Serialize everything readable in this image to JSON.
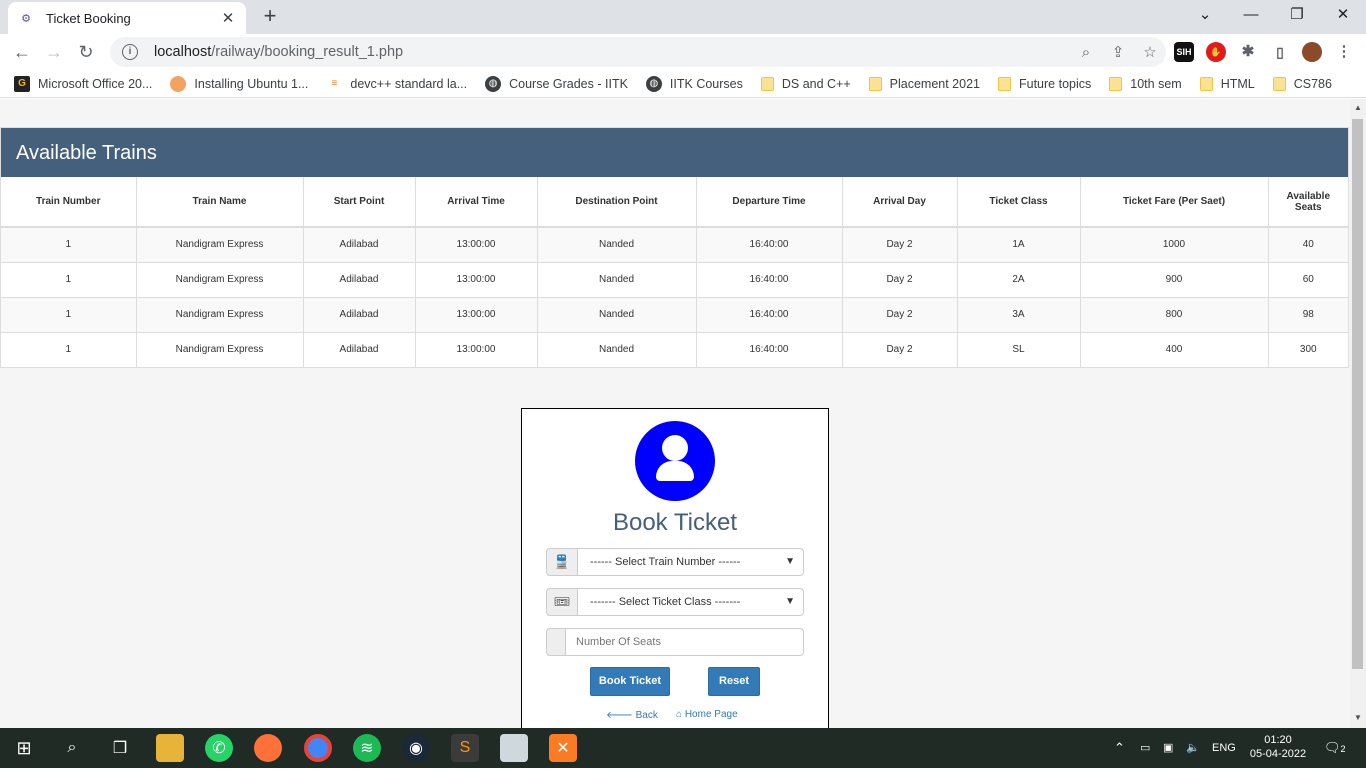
{
  "browser": {
    "tab_title": "Ticket Booking",
    "url_host": "localhost",
    "url_path": "/railway/booking_result_1.php",
    "bookmarks": [
      {
        "label": "Microsoft Office 20...",
        "icon": "office-icon"
      },
      {
        "label": "Installing Ubuntu 1...",
        "icon": "ubuntu-icon"
      },
      {
        "label": "devc++ standard la...",
        "icon": "stackoverflow-icon"
      },
      {
        "label": "Course Grades - IITK",
        "icon": "globe-icon"
      },
      {
        "label": "IITK Courses",
        "icon": "globe-icon"
      },
      {
        "label": "DS and C++",
        "icon": "folder-icon"
      },
      {
        "label": "Placement 2021",
        "icon": "folder-icon"
      },
      {
        "label": "Future topics",
        "icon": "folder-icon"
      },
      {
        "label": "10th sem",
        "icon": "folder-icon"
      },
      {
        "label": "HTML",
        "icon": "folder-icon"
      },
      {
        "label": "CS786",
        "icon": "folder-icon"
      }
    ]
  },
  "trains": {
    "heading": "Available Trains",
    "columns": [
      "Train Number",
      "Train Name",
      "Start Point",
      "Arrival Time",
      "Destination Point",
      "Departure Time",
      "Arrival Day",
      "Ticket Class",
      "Ticket Fare (Per Saet)",
      "Available Seats"
    ],
    "rows": [
      [
        "1",
        "Nandigram Express",
        "Adilabad",
        "13:00:00",
        "Nanded",
        "16:40:00",
        "Day 2",
        "1A",
        "1000",
        "40"
      ],
      [
        "1",
        "Nandigram Express",
        "Adilabad",
        "13:00:00",
        "Nanded",
        "16:40:00",
        "Day 2",
        "2A",
        "900",
        "60"
      ],
      [
        "1",
        "Nandigram Express",
        "Adilabad",
        "13:00:00",
        "Nanded",
        "16:40:00",
        "Day 2",
        "3A",
        "800",
        "98"
      ],
      [
        "1",
        "Nandigram Express",
        "Adilabad",
        "13:00:00",
        "Nanded",
        "16:40:00",
        "Day 2",
        "SL",
        "400",
        "300"
      ]
    ]
  },
  "form": {
    "title": "Book Ticket",
    "train_select": "------ Select Train Number ------",
    "class_select": "------- Select Ticket Class -------",
    "seats_placeholder": "Number Of Seats",
    "book_button": "Book Ticket",
    "reset_button": "Reset",
    "back_link": "Back",
    "home_link": "Home Page"
  },
  "taskbar": {
    "language": "ENG",
    "time": "01:20",
    "date": "05-04-2022",
    "notifications": "2"
  },
  "colors": {
    "panel_heading": "#45607d",
    "avatar": "#0000ff",
    "button": "#337ab7",
    "taskbar": "#1f2b24"
  }
}
